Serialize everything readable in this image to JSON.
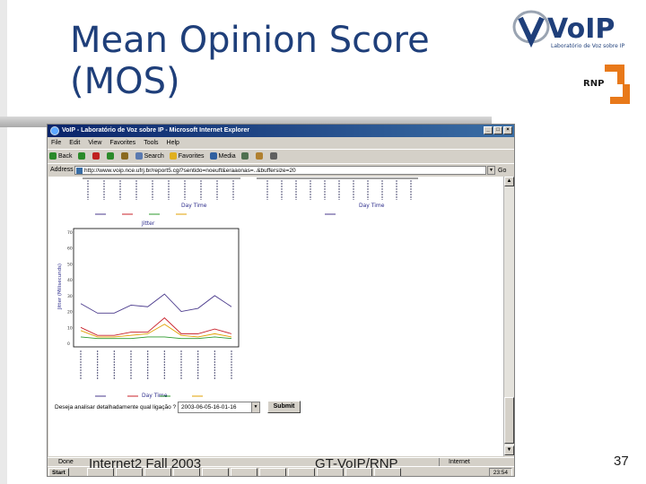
{
  "slide": {
    "title": "Mean Opinion Score (MOS)",
    "footer_left": "Internet2 Fall 2003",
    "footer_center": "GT-VoIP/RNP",
    "page_number": "37",
    "logo_voip_text": "VoIP",
    "logo_voip_subtitle": "Laboratório de Voz sobre IP",
    "logo_rnp_text": "RNP"
  },
  "browser": {
    "window_title": "VoIP - Laboratório de Voz sobre IP - Microsoft Internet Explorer",
    "menu": [
      "File",
      "Edit",
      "View",
      "Favorites",
      "Tools",
      "Help"
    ],
    "toolbar": {
      "back": "Back",
      "search": "Search",
      "favorites": "Favorites",
      "media": "Media"
    },
    "address_label": "Address",
    "address_url": "http://www.voip.nce.ufrj.br/report5.cgi?sentido=noeuft&eraaonas=..&buffersize=20",
    "go_label": "Go",
    "status": "Done",
    "zone": "Internet",
    "start_label": "Start",
    "clock": "23:54"
  },
  "page": {
    "top_chart_xlabel": "Day Time",
    "jitter_title": "Jitter",
    "jitter_ylabel": "Jitter (Milisecunds)",
    "jitter_xlabel": "Day Time",
    "combo_label": "Deseja analisar detalhadamente qual ligação ?",
    "combo_value": "2003-06-05-16-01-16",
    "submit_label": "Submit"
  },
  "colors": {
    "title": "#1f3f7a",
    "series_max": "#4a3a8c",
    "series_avg": "#c8202a",
    "series_min": "#2c9a2c",
    "series_stdev": "#e0a000"
  },
  "chart_data": {
    "type": "line",
    "title": "Jitter",
    "xlabel": "Day Time",
    "ylabel": "Jitter (Milisecunds)",
    "ylim": [
      0,
      70
    ],
    "yticks": [
      0,
      10,
      20,
      30,
      40,
      50,
      60,
      70
    ],
    "series": [
      {
        "values": [
          25,
          19,
          19,
          24,
          23,
          31,
          20,
          22,
          30,
          23
        ]
      },
      {
        "values": [
          10,
          5,
          5,
          7,
          7,
          16,
          6,
          6,
          9,
          6
        ]
      },
      {
        "values": [
          4,
          3,
          3,
          3,
          4,
          4,
          3,
          3,
          4,
          3
        ]
      },
      {
        "values": [
          8,
          4,
          4,
          5,
          6,
          12,
          5,
          4,
          6,
          4
        ]
      }
    ]
  }
}
